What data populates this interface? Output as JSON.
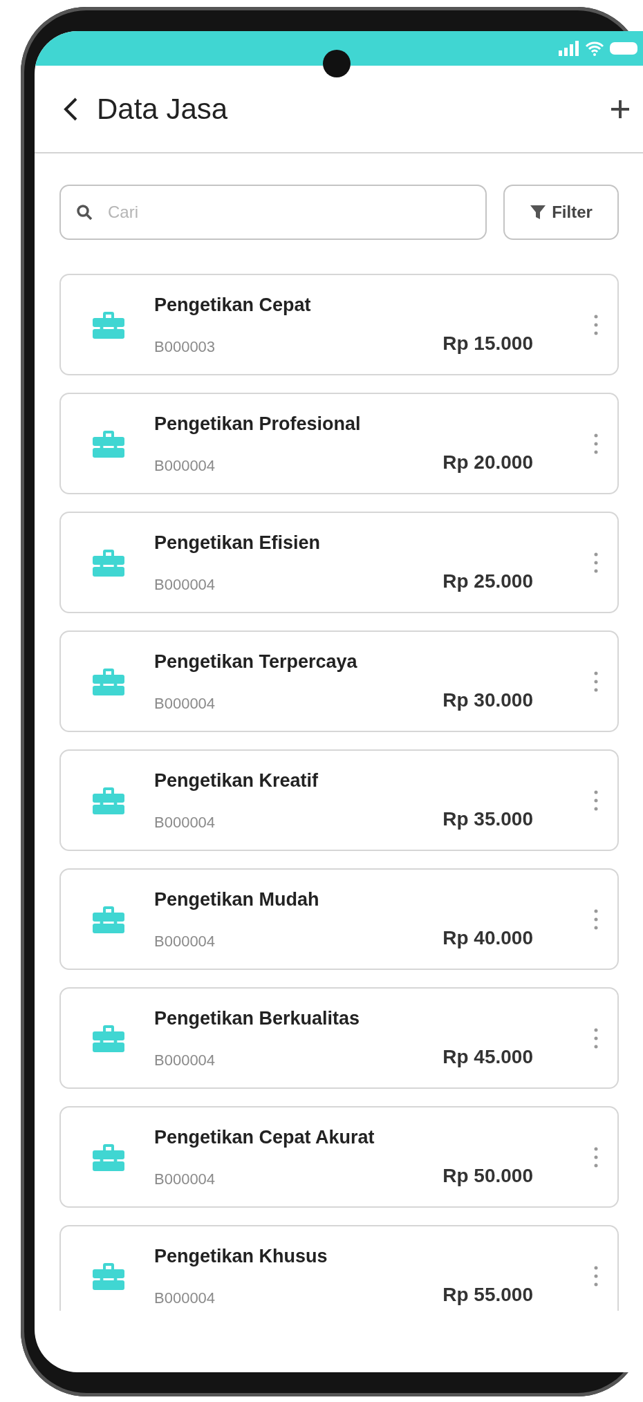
{
  "header": {
    "title": "Data Jasa"
  },
  "search": {
    "placeholder": "Cari"
  },
  "filter_button": {
    "label": "Filter"
  },
  "services": [
    {
      "name": "Pengetikan Cepat",
      "code": "B000003",
      "price": "Rp 15.000"
    },
    {
      "name": "Pengetikan Profesional",
      "code": "B000004",
      "price": "Rp 20.000"
    },
    {
      "name": "Pengetikan Efisien",
      "code": "B000004",
      "price": "Rp 25.000"
    },
    {
      "name": "Pengetikan Terpercaya",
      "code": "B000004",
      "price": "Rp 30.000"
    },
    {
      "name": "Pengetikan Kreatif",
      "code": "B000004",
      "price": "Rp 35.000"
    },
    {
      "name": "Pengetikan Mudah",
      "code": "B000004",
      "price": "Rp 40.000"
    },
    {
      "name": "Pengetikan Berkualitas",
      "code": "B000004",
      "price": "Rp 45.000"
    },
    {
      "name": "Pengetikan Cepat Akurat",
      "code": "B000004",
      "price": "Rp 50.000"
    },
    {
      "name": "Pengetikan Khusus",
      "code": "B000004",
      "price": "Rp 55.000"
    }
  ]
}
